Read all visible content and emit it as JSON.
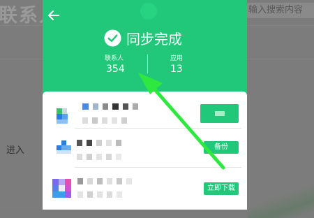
{
  "background": {
    "title": "联系人",
    "search_placeholder": "输入搜索内容",
    "enter_text": "进入"
  },
  "header": {
    "back_icon": "back-arrow-icon",
    "title": "同步完成",
    "stats": [
      {
        "label": "联系人",
        "value": "354"
      },
      {
        "label": "应用",
        "value": "13"
      }
    ]
  },
  "list": [
    {
      "icon": "blurred-app-icon",
      "button_label": "",
      "button_style": "filled"
    },
    {
      "icon": "blurred-app-icon",
      "button_label": "备份",
      "button_style": "filled"
    },
    {
      "icon": "blurred-app-icon",
      "button_label": "立即下载",
      "button_style": "filled"
    }
  ],
  "colors": {
    "accent": "#21c87a",
    "overlay": "#7b7b7b",
    "annotation_arrow": "#2ee840"
  }
}
